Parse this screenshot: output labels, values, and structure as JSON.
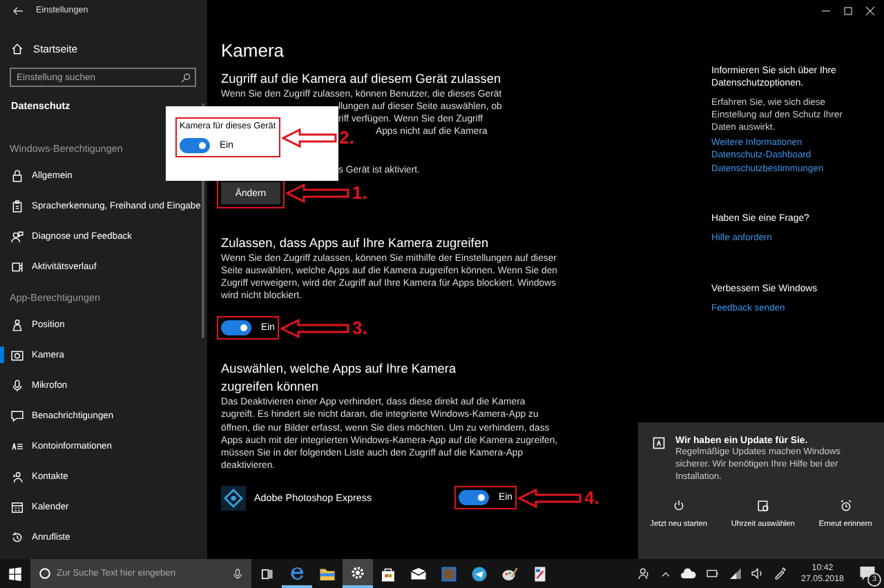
{
  "window": {
    "title": "Einstellungen"
  },
  "sidebar": {
    "home": "Startseite",
    "search": {
      "placeholder": "Einstellung suchen"
    },
    "section": "Datenschutz",
    "groups": [
      {
        "heading": "Windows-Berechtigungen",
        "items": [
          {
            "label": "Allgemein",
            "selected": false
          },
          {
            "label": "Spracherkennung, Freihand und Eingabe",
            "selected": false
          },
          {
            "label": "Diagnose und Feedback",
            "selected": false
          },
          {
            "label": "Aktivitätsverlauf",
            "selected": false
          }
        ]
      },
      {
        "heading": "App-Berechtigungen",
        "items": [
          {
            "label": "Position",
            "selected": false
          },
          {
            "label": "Kamera",
            "selected": true
          },
          {
            "label": "Mikrofon",
            "selected": false
          },
          {
            "label": "Benachrichtigungen",
            "selected": false
          },
          {
            "label": "Kontoinformationen",
            "selected": false
          },
          {
            "label": "Kontakte",
            "selected": false
          },
          {
            "label": "Kalender",
            "selected": false
          },
          {
            "label": "Anrufliste",
            "selected": false
          }
        ]
      }
    ]
  },
  "page": {
    "title": "Kamera",
    "device_section": {
      "heading": "Zugriff auf die Kamera auf diesem Gerät zulassen",
      "paragraph_lines": [
        "Wenn Sie den Zugriff zulassen, können Benutzer, die dieses Gerät",
        "llungen auf dieser Seite auswählen, ob",
        "riff verfügen. Wenn Sie den Zugriff",
        "Apps nicht auf die Kamera"
      ],
      "status": "s Gerät ist aktiviert.",
      "button": "Ändern"
    },
    "apps_section": {
      "heading": "Zulassen, dass Apps auf Ihre Kamera zugreifen",
      "paragraph": "Wenn Sie den Zugriff zulassen, können Sie mithilfe der Einstellungen auf dieser Seite auswählen, welche Apps auf die Kamera zugreifen können. Wenn Sie den Zugriff verweigern, wird der Zugriff auf Ihre Kamera für Apps blockiert. Windows wird nicht blockiert.",
      "toggle": {
        "label": "Ein",
        "on": true
      }
    },
    "choose_section": {
      "heading": "Auswählen, welche Apps auf Ihre Kamera zugreifen können",
      "paragraph": "Das Deaktivieren einer App verhindert, dass diese direkt auf die Kamera zugreift. Es hindert sie nicht daran, die integrierte Windows-Kamera-App zu öffnen, die nur Bilder erfasst, wenn Sie dies möchten. Um zu verhindern, dass Apps auch mit der integrierten Windows-Kamera-App auf die Kamera zugreifen, müssen Sie in der folgenden Liste auch den Zugriff auf die Kamera-App deaktivieren.",
      "apps": [
        {
          "name": "Adobe Photoshop Express",
          "toggle": {
            "label": "Ein",
            "on": true
          }
        }
      ]
    }
  },
  "popup": {
    "label": "Kamera für dieses Gerät",
    "toggle": {
      "label": "Ein",
      "on": true
    }
  },
  "side_panel": {
    "heading": "Informieren Sie sich über Ihre Datenschutzoptionen.",
    "text": "Erfahren Sie, wie sich diese Einstellung auf den Schutz Ihrer Daten auswirkt.",
    "links": [
      "Weitere Informationen",
      "Datenschutz-Dashboard",
      "Datenschutzbestimmungen"
    ],
    "help": {
      "heading": "Haben Sie eine Frage?",
      "links": [
        "Hilfe anfordern"
      ]
    },
    "feedback": {
      "heading": "Verbessern Sie Windows",
      "links": [
        "Feedback senden"
      ]
    }
  },
  "annotations": [
    {
      "number": "1."
    },
    {
      "number": "2."
    },
    {
      "number": "3."
    },
    {
      "number": "4."
    }
  ],
  "toast": {
    "title": "Wir haben ein Update für Sie.",
    "text": "Regelmäßige Updates machen Windows sicherer. Wir benötigen Ihre Hilfe bei der Installation.",
    "actions": [
      "Jetzt neu starten",
      "Uhrzeit auswählen",
      "Erneut erinnern"
    ]
  },
  "taskbar": {
    "search": {
      "placeholder": "Zur Suche Text hier eingeben"
    },
    "apps": [
      {
        "selected": false,
        "running": true
      },
      {
        "selected": false,
        "running": false
      },
      {
        "selected": true,
        "running": true
      },
      {
        "selected": false,
        "running": false
      },
      {
        "selected": false,
        "running": false
      },
      {
        "selected": false,
        "running": false
      },
      {
        "selected": false,
        "running": false
      },
      {
        "selected": false,
        "running": false
      },
      {
        "selected": false,
        "running": false
      }
    ],
    "clock": {
      "time": "10:42",
      "date": "27.05.2018"
    },
    "notifications": {
      "count": "3"
    }
  }
}
